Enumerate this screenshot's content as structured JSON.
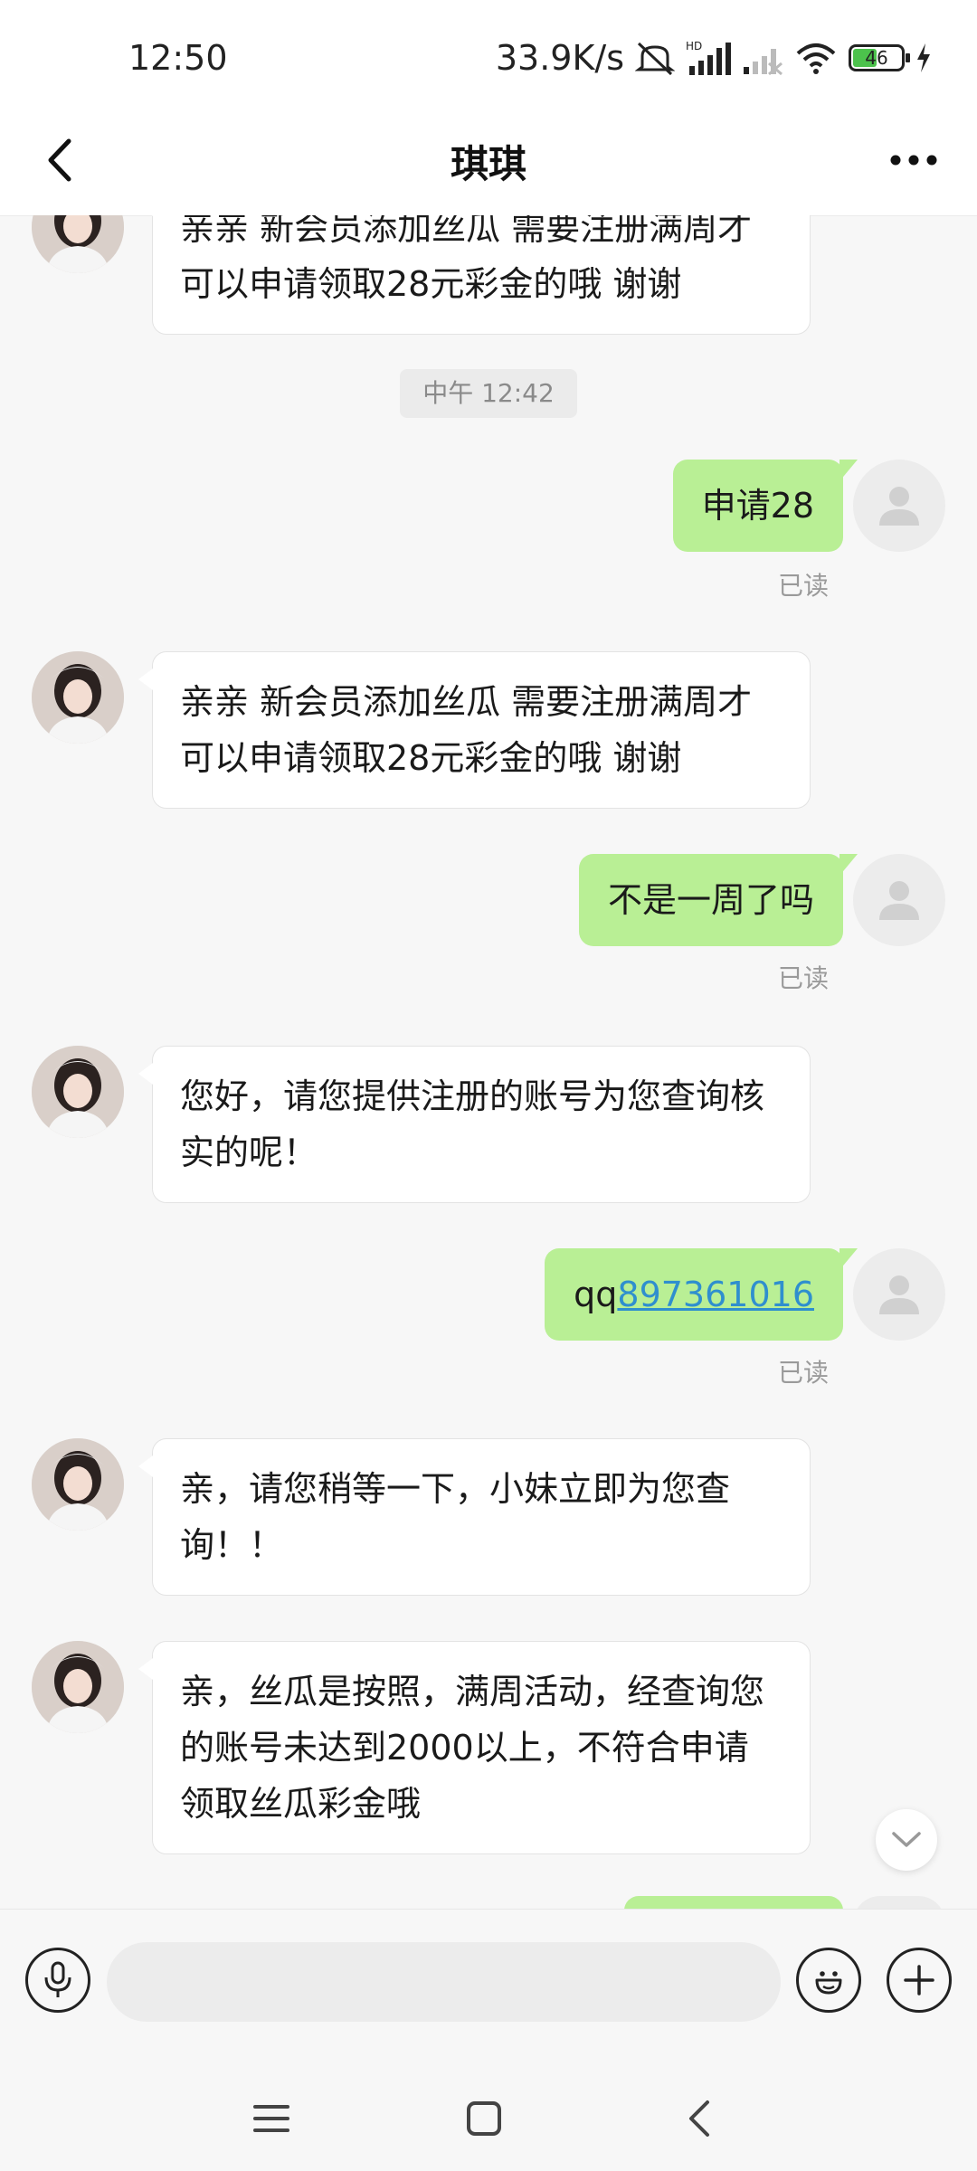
{
  "status_bar": {
    "time": "12:50",
    "network_speed": "33.9K/s",
    "battery": "46",
    "icons": [
      "mute-icon",
      "hd-signal-icon",
      "signal-weak-icon",
      "wifi-icon",
      "battery-icon",
      "charging-icon"
    ]
  },
  "header": {
    "title": "琪琪",
    "back_icon": "back-arrow-icon",
    "more_icon": "more-dots-icon"
  },
  "chat": {
    "timestamp": "中午 12:42",
    "read_label": "已读",
    "messages": [
      {
        "from": "other",
        "text": "亲亲   新会员添加丝瓜 需要注册满周才可以申请领取28元彩金的哦   谢谢"
      },
      {
        "from": "me",
        "text": "申请28",
        "status": "已读"
      },
      {
        "from": "other",
        "text": "亲亲   新会员添加丝瓜 需要注册满周才可以申请领取28元彩金的哦   谢谢"
      },
      {
        "from": "me",
        "text": "不是一周了吗",
        "status": "已读"
      },
      {
        "from": "other",
        "text": "您好，请您提供注册的账号为您查询核实的呢！"
      },
      {
        "from": "me",
        "text_prefix": "qq",
        "text_link": "897361016",
        "status": "已读"
      },
      {
        "from": "other",
        "text": "亲，请您稍等一下，小妹立即为您查询！！"
      },
      {
        "from": "other",
        "text": "亲，丝瓜是按照，满周活动，经查询您的账号未达到2000以上，不符合申请领取丝瓜彩金哦"
      }
    ]
  },
  "input_bar": {
    "placeholder": "",
    "value": ""
  },
  "colors": {
    "outgoing_bubble": "#b9ef95",
    "incoming_bubble": "#ffffff",
    "link": "#2f8fce",
    "background": "#f7f7f7"
  }
}
